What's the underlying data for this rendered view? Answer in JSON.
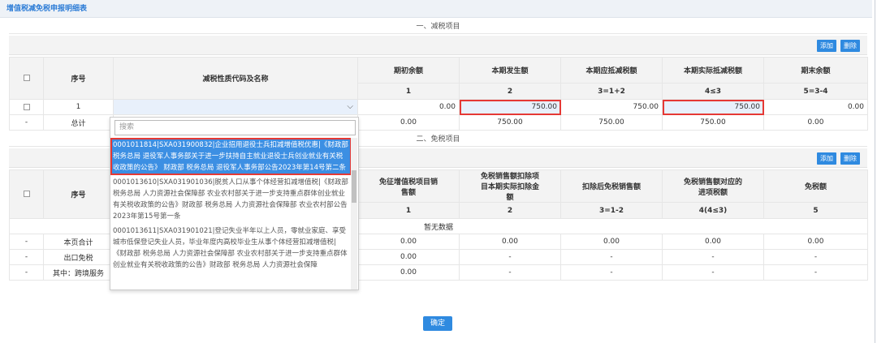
{
  "title": "增值税减免税申报明细表",
  "section1": {
    "heading": "一、减税项目",
    "add_label": "添加",
    "delete_label": "删除",
    "headers": {
      "seq": "序号",
      "code": "减税性质代码及名称",
      "opening": "期初余额",
      "current": "本期发生额",
      "should": "本期应抵减税额",
      "actual": "本期实际抵减税额",
      "closing": "期末余额"
    },
    "index_row": [
      "1",
      "2",
      "3=1+2",
      "4≤3",
      "5=3-4"
    ],
    "row1": {
      "seq": "1",
      "opening": "0.00",
      "current": "750.00",
      "should": "750.00",
      "actual": "750.00",
      "closing": "0.00"
    },
    "total": {
      "dash": "-",
      "label": "总计",
      "opening": "0.00",
      "current": "750.00",
      "should": "750.00",
      "actual": "750.00",
      "closing": "0.00"
    }
  },
  "dropdown": {
    "search_placeholder": "搜索",
    "items": [
      "0001011814|SXA031900832|企业招用退役士兵扣减增值税优惠|《财政部 税务总局 退役军人事务部关于进一步扶持自主就业退役士兵创业就业有关税收政策的公告》 财政部 税务总局 退役军人事务部公告2023年第14号第二条",
      "0001013610|SXA031901036|脱贫人口从事个体经营扣减增值税|《财政部 税务总局 人力资源社会保障部 农业农村部关于进一步支持重点群体创业就业有关税收政策的公告》财政部 税务总局 人力资源社会保障部 农业农村部公告2023年第15号第一条",
      "0001013611|SXA031901021|登记失业半年以上人员，零就业家庭、享受城市低保登记失业人员，毕业年度内高校毕业生从事个体经营扣减增值税|《财政部 税务总局 人力资源社会保障部 农业农村部关于进一步支持重点群体创业就业有关税收政策的公告》财政部 税务总局 人力资源社会保障"
    ]
  },
  "section2": {
    "heading": "二、免税项目",
    "add_label": "添加",
    "delete_label": "删除",
    "headers": {
      "seq": "序号",
      "sales": "免征增值税项目销售额",
      "deduct": "免税销售额扣除项目本期实际扣除金额",
      "after": "扣除后免税销售额",
      "input": "免税销售额对应的进项税额",
      "exempt": "免税额"
    },
    "index_row": [
      "1",
      "2",
      "3=1-2",
      "4(4≤3)",
      "5"
    ],
    "no_data": "暂无数据",
    "rows": [
      {
        "dash": "-",
        "label": "本页合计",
        "c1": "0.00",
        "c2": "0.00",
        "c3": "0.00",
        "c4": "0.00",
        "c5": "0.00"
      },
      {
        "dash": "-",
        "label": "出口免税",
        "c1": "0.00",
        "c2": "-",
        "c3": "-",
        "c4": "-",
        "c5": "-"
      },
      {
        "dash": "-",
        "label": "其中：跨境服务",
        "c1": "0.00",
        "c2": "-",
        "c3": "-",
        "c4": "-",
        "c5": "-"
      }
    ]
  },
  "confirm_label": "确定"
}
